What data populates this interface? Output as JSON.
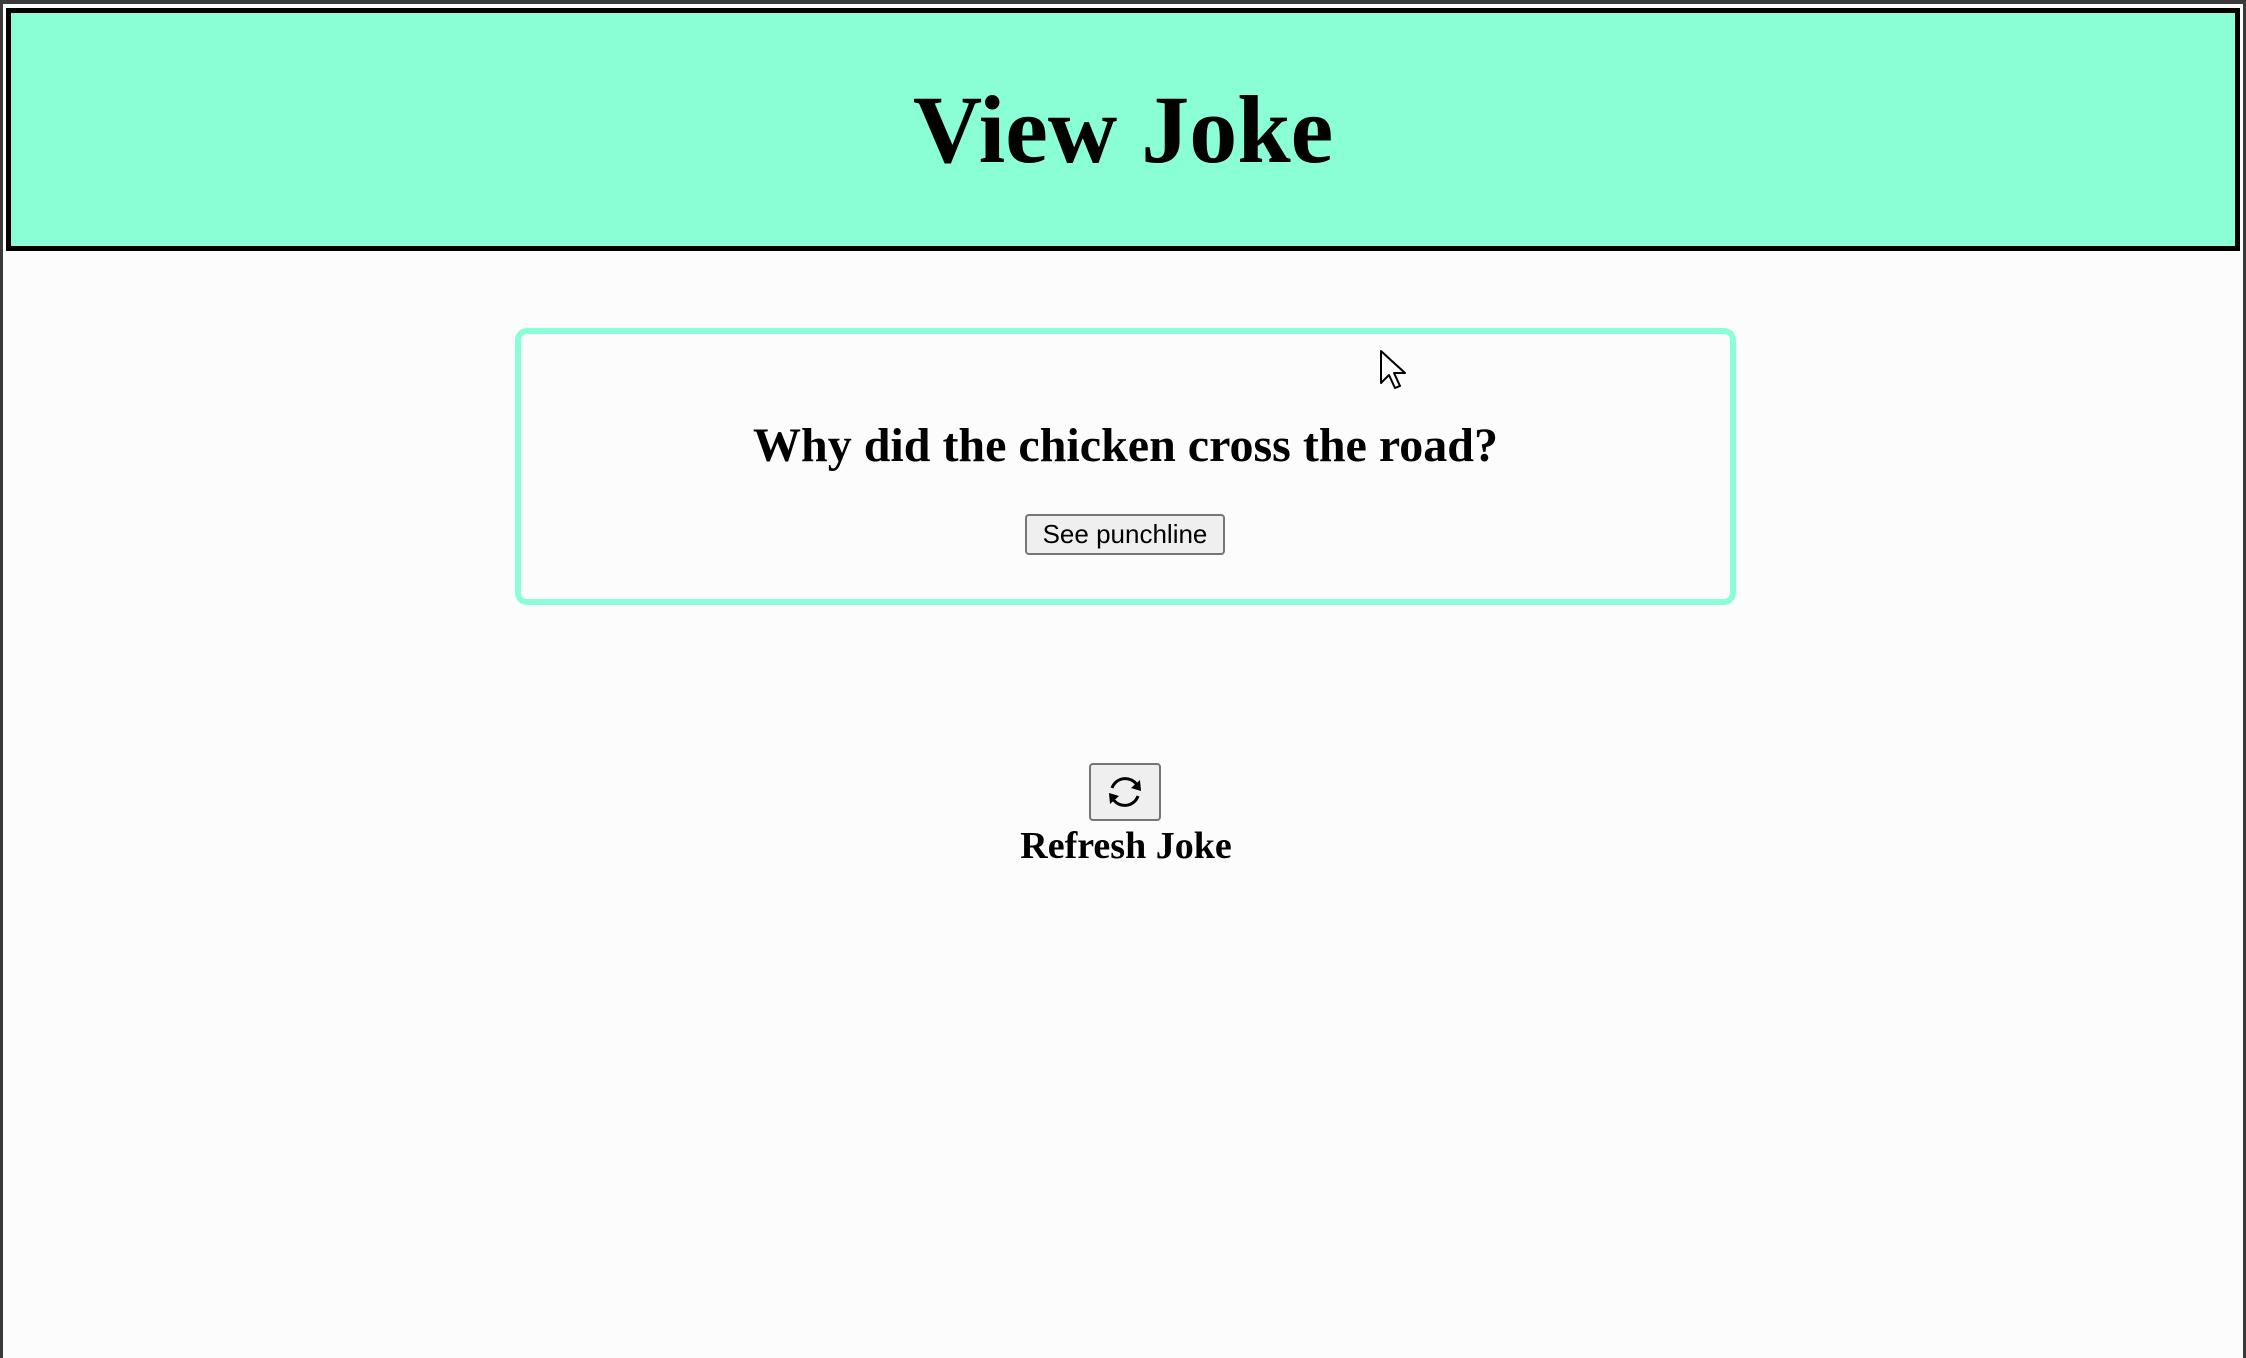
{
  "header": {
    "title": "View Joke"
  },
  "joke": {
    "setup": "Why did the chicken cross the road?",
    "punchline_button_label": "See punchline"
  },
  "refresh": {
    "icon": "refresh-icon",
    "label": "Refresh Joke"
  },
  "colors": {
    "accent": "#8affd6",
    "border": "#000000",
    "background": "#fcfcfc"
  }
}
